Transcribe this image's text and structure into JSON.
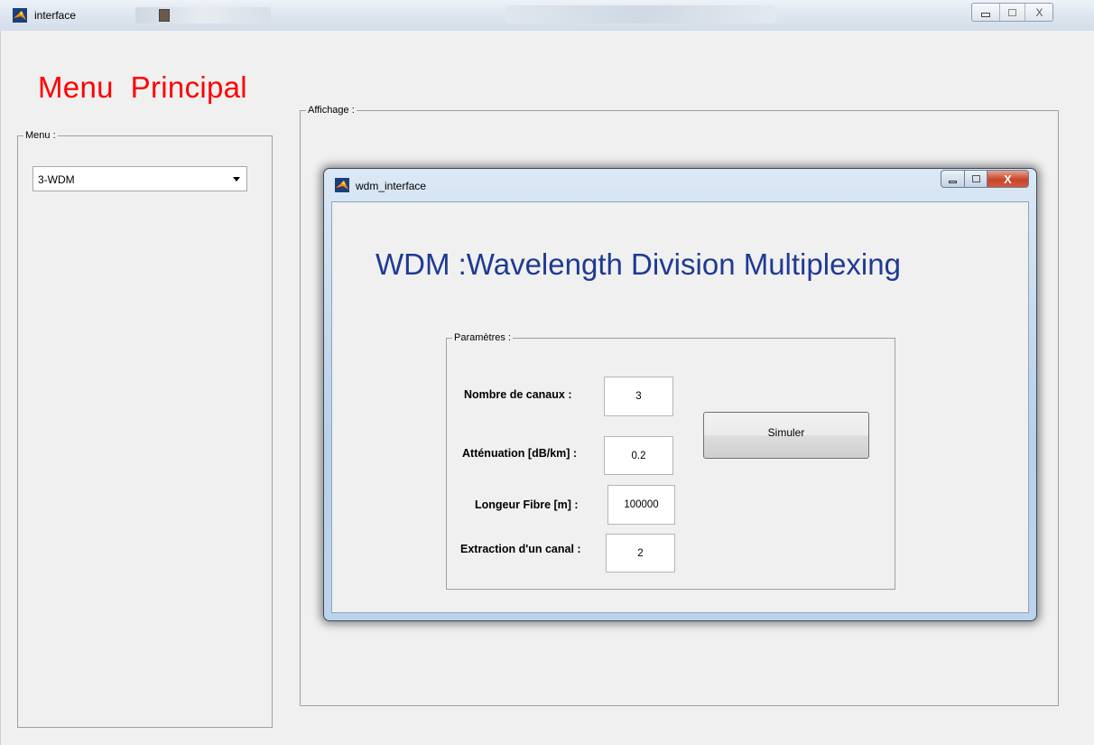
{
  "window": {
    "title": "interface",
    "controls": {
      "minimize": "▭",
      "maximize": "□",
      "close": "X"
    }
  },
  "menu": {
    "heading": "Menu  Principal",
    "group_label": "Menu :",
    "select_value": "3-WDM"
  },
  "display": {
    "group_label": "Affichage :"
  },
  "inner_window": {
    "title": "wdm_interface",
    "heading": "WDM :Wavelength Division Multiplexing",
    "params_label": "Paramètres :",
    "params": [
      {
        "label": "Nombre  de canaux :",
        "value": "3"
      },
      {
        "label": "Atténuation [dB/km] :",
        "value": "0.2"
      },
      {
        "label": "Longeur Fibre  [m] :",
        "value": "100000"
      },
      {
        "label": "Extraction d'un canal :",
        "value": "2"
      }
    ],
    "simulate_label": "Simuler"
  },
  "colors": {
    "menu_heading": "#ff0000",
    "wdm_heading": "#1f3a93",
    "close_button": "#c8452c"
  }
}
